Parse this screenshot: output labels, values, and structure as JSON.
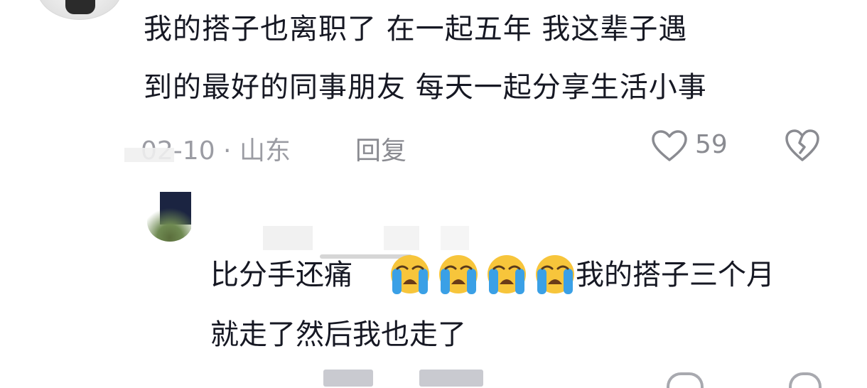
{
  "comment": {
    "text_line1": "我的搭子也离职了 在一起五年 我这辈子遇",
    "text_line2": "到的最好的同事朋友 每天一起分享生活小事",
    "meta": "02-10 · 山东",
    "reply_label": "回复",
    "like_count": "59",
    "icons": {
      "like": "heart-outline-icon",
      "dislike": "broken-heart-icon"
    }
  },
  "reply": {
    "text_seg1": "比分手还痛",
    "emojis": [
      "loudly-crying-face",
      "loudly-crying-face",
      "loudly-crying-face",
      "loudly-crying-face"
    ],
    "text_seg2": "我的搭子三个月",
    "text_line2": "就走了然后我也走了"
  },
  "colors": {
    "text": "#161823",
    "meta": "#9b9ca3",
    "action": "#8a8b91"
  }
}
